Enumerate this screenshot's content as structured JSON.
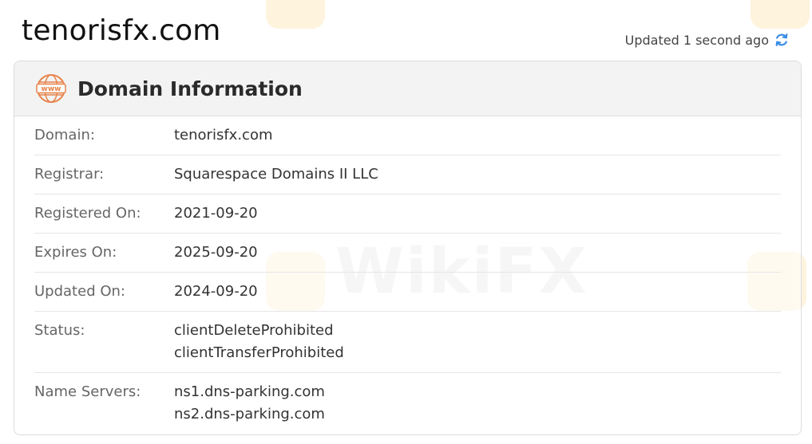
{
  "site": {
    "title": "tenorisfx.com",
    "updated_text": "Updated 1 second ago",
    "refresh_icon": "refresh-icon",
    "accent_color": "#3a8ee6"
  },
  "card": {
    "icon": "www-icon",
    "icon_text": "www",
    "icon_color": "#e8834a",
    "title": "Domain Information",
    "rows": [
      {
        "label": "Domain:",
        "values": [
          "tenorisfx.com"
        ]
      },
      {
        "label": "Registrar:",
        "values": [
          "Squarespace Domains II LLC"
        ]
      },
      {
        "label": "Registered On:",
        "values": [
          "2021-09-20"
        ]
      },
      {
        "label": "Expires On:",
        "values": [
          "2025-09-20"
        ]
      },
      {
        "label": "Updated On:",
        "values": [
          "2024-09-20"
        ]
      },
      {
        "label": "Status:",
        "values": [
          "clientDeleteProhibited",
          "clientTransferProhibited"
        ]
      },
      {
        "label": "Name Servers:",
        "values": [
          "ns1.dns-parking.com",
          "ns2.dns-parking.com"
        ]
      }
    ]
  },
  "watermark": {
    "text": "WikiFX"
  }
}
